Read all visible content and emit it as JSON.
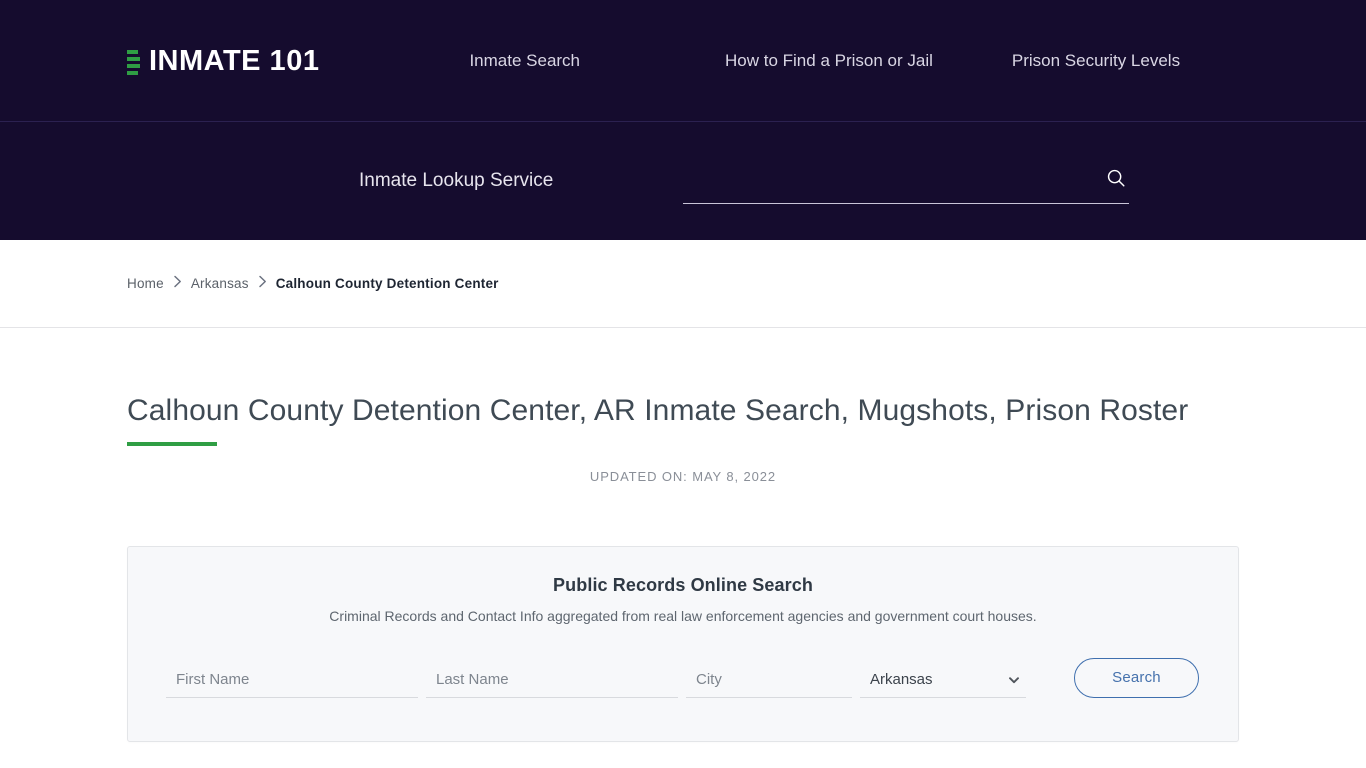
{
  "site": {
    "logo_text": "INMATE 101",
    "logo_icon": "bars-logo-icon",
    "accent_green": "#2f9e44",
    "header_bg": "#150c2e",
    "link_blue": "#4672ad"
  },
  "nav": {
    "items": [
      {
        "label": "Inmate Search"
      },
      {
        "label": "How to Find a Prison or Jail"
      },
      {
        "label": "Prison Security Levels"
      }
    ]
  },
  "lookup": {
    "label": "Inmate Lookup Service",
    "search_value": "",
    "search_placeholder": "",
    "search_icon": "search-icon"
  },
  "breadcrumb": {
    "items": [
      {
        "label": "Home",
        "current": false
      },
      {
        "label": "Arkansas",
        "current": false
      },
      {
        "label": "Calhoun County Detention Center",
        "current": true
      }
    ],
    "separator": "›"
  },
  "page": {
    "title": "Calhoun County Detention Center, AR Inmate Search, Mugshots, Prison Roster",
    "updated": "UPDATED ON: MAY 8, 2022"
  },
  "records_card": {
    "heading": "Public Records Online Search",
    "subheading": "Criminal Records and Contact Info aggregated from real law enforcement agencies and government court houses.",
    "fields": {
      "first_name": {
        "value": "",
        "placeholder": "First Name"
      },
      "last_name": {
        "value": "",
        "placeholder": "Last Name"
      },
      "city": {
        "value": "",
        "placeholder": "City"
      },
      "state": {
        "selected": "Arkansas",
        "options": [
          "Arkansas"
        ],
        "icon": "chevron-down-icon"
      }
    },
    "search_button": "Search"
  }
}
